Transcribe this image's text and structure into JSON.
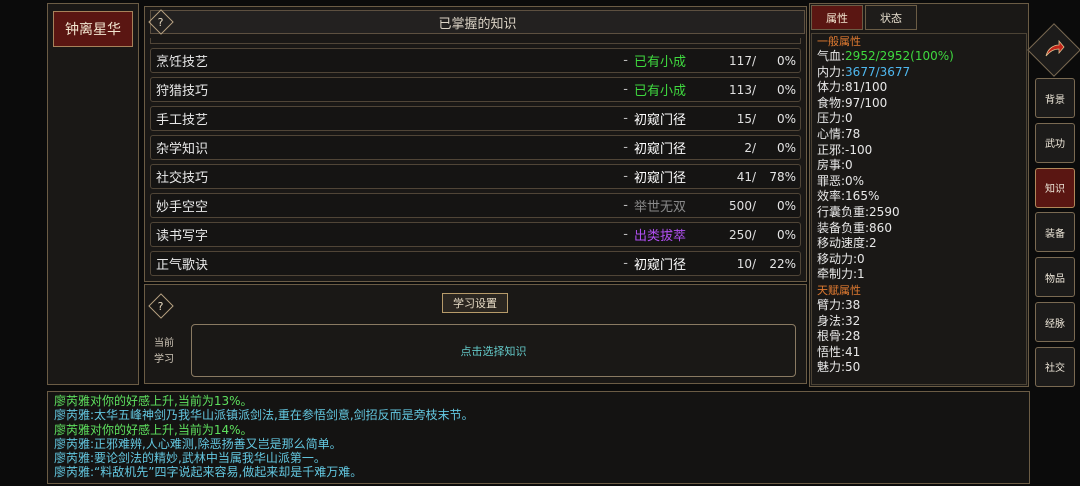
{
  "character": {
    "name": "钟离星华"
  },
  "knowledge": {
    "title": "已掌握的知识",
    "help": "?",
    "rows": [
      {
        "name": "烹饪技艺",
        "level": "已有小成",
        "value": "117/",
        "pct": "0%",
        "color": "#3fd93f"
      },
      {
        "name": "狩猎技巧",
        "level": "已有小成",
        "value": "113/",
        "pct": "0%",
        "color": "#3fd93f"
      },
      {
        "name": "手工技艺",
        "level": "初窥门径",
        "value": "15/",
        "pct": "0%",
        "color": "#ffffff"
      },
      {
        "name": "杂学知识",
        "level": "初窥门径",
        "value": "2/",
        "pct": "0%",
        "color": "#ffffff"
      },
      {
        "name": "社交技巧",
        "level": "初窥门径",
        "value": "41/",
        "pct": "78%",
        "color": "#ffffff"
      },
      {
        "name": "妙手空空",
        "level": "举世无双",
        "value": "500/",
        "pct": "0%",
        "color": "#8a8a8a"
      },
      {
        "name": "读书写字",
        "level": "出类拔萃",
        "value": "250/",
        "pct": "0%",
        "color": "#b04ff0"
      },
      {
        "name": "正气歌诀",
        "level": "初窥门径",
        "value": "10/",
        "pct": "22%",
        "color": "#ffffff"
      }
    ],
    "dash": "-"
  },
  "study": {
    "help": "?",
    "settings_label": "学习设置",
    "current_label_1": "当前",
    "current_label_2": "学习",
    "select_prompt": "点击选择知识"
  },
  "attributes": {
    "tabs": [
      "属性",
      "状态"
    ],
    "general_title": "一般属性",
    "general": [
      {
        "label": "气血:",
        "value": "2952/2952(100%)",
        "color": "#3fd93f"
      },
      {
        "label": "内力:",
        "value": "3677/3677",
        "color": "#4fb8f0"
      },
      {
        "label": "体力:",
        "value": "81/100"
      },
      {
        "label": "食物:",
        "value": "97/100"
      },
      {
        "label": "压力:",
        "value": "0"
      },
      {
        "label": "心情:",
        "value": "78"
      },
      {
        "label": "正邪:",
        "value": "-100"
      },
      {
        "label": "房事:",
        "value": "0"
      },
      {
        "label": "罪恶:",
        "value": "0%"
      },
      {
        "label": "效率:",
        "value": "165%"
      },
      {
        "label": "行囊负重:",
        "value": "2590"
      },
      {
        "label": "装备负重:",
        "value": "860"
      },
      {
        "label": "移动速度:",
        "value": "2"
      },
      {
        "label": "移动力:",
        "value": "0"
      },
      {
        "label": "牵制力:",
        "value": "1"
      }
    ],
    "talent_title": "天赋属性",
    "talent": [
      {
        "label": "臂力:",
        "value": "38"
      },
      {
        "label": "身法:",
        "value": "32"
      },
      {
        "label": "根骨:",
        "value": "28"
      },
      {
        "label": "悟性:",
        "value": "41"
      },
      {
        "label": "魅力:",
        "value": "50"
      }
    ]
  },
  "sidebar": {
    "items": [
      "背景",
      "武功",
      "知识",
      "装备",
      "物品",
      "经脉",
      "社交"
    ],
    "active": 2
  },
  "log": {
    "lines": [
      {
        "text": "廖芮雅对你的好感上升,当前为13%。",
        "color": "#5ee05e"
      },
      {
        "text": "廖芮雅:太华五峰神剑乃我华山派镇派剑法,重在参悟剑意,剑招反而是旁枝末节。",
        "color": "#63c7e0"
      },
      {
        "text": "廖芮雅对你的好感上升,当前为14%。",
        "color": "#5ee05e"
      },
      {
        "text": "廖芮雅:正邪难辨,人心难测,除恶扬善又岂是那么简单。",
        "color": "#63c7e0"
      },
      {
        "text": "廖芮雅:要论剑法的精妙,武林中当属我华山派第一。",
        "color": "#63c7e0"
      },
      {
        "text": "廖芮雅:“料敌机先”四字说起来容易,做起来却是千难万难。",
        "color": "#63c7e0"
      }
    ]
  }
}
